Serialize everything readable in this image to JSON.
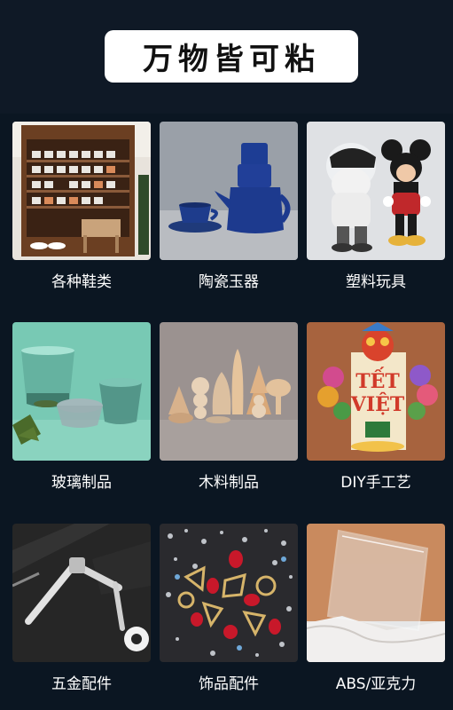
{
  "header": {
    "title": "万物皆可粘"
  },
  "items": [
    {
      "label": "各种鞋类",
      "image": "shoe-cabinet"
    },
    {
      "label": "陶瓷玉器",
      "image": "ceramic-teapot-set"
    },
    {
      "label": "塑料玩具",
      "image": "mickey-toy-figures"
    },
    {
      "label": "玻璃制品",
      "image": "glass-bowls"
    },
    {
      "label": "木料制品",
      "image": "wooden-figurines"
    },
    {
      "label": "DIY手工艺",
      "image": "diy-craft-poster"
    },
    {
      "label": "五金配件",
      "image": "door-handle"
    },
    {
      "label": "饰品配件",
      "image": "rhinestones"
    },
    {
      "label": "ABS/亚克力",
      "image": "acrylic-sheet"
    }
  ],
  "craft_poster": {
    "line1": "TẾT",
    "line2": "VIỆT"
  }
}
